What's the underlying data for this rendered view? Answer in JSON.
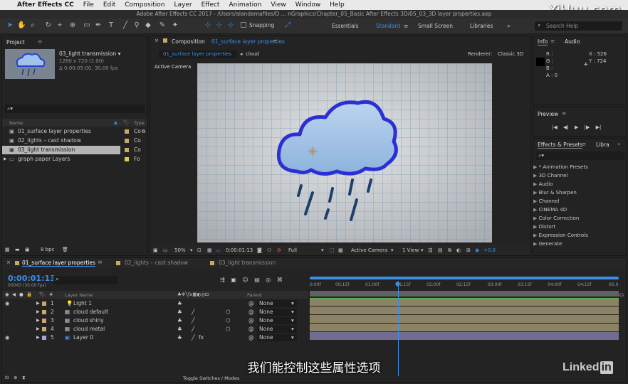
{
  "menubar": {
    "app": "After Effects CC",
    "items": [
      "File",
      "Edit",
      "Composition",
      "Layer",
      "Effect",
      "Animation",
      "View",
      "Window",
      "Help"
    ]
  },
  "watermark": "YiHuu.com",
  "window_title": "Adobe After Effects CC 2017 - /Users/alandemafiles/D ... nGraphics/Chapter_05_Basic After Effects 3D/05_03_3D layer properties.aep",
  "toolbar": {
    "snapping": "Snapping",
    "workspaces": [
      "Essentials",
      "Standard",
      "Small Screen",
      "Libraries"
    ],
    "search_placeholder": "Search Help"
  },
  "project": {
    "title": "Project",
    "thumb_name": "03_light transmission ▾",
    "thumb_res": "1280 x 720 (1.00)",
    "thumb_dur": "Δ 0:00:05:00, 30.00 fps",
    "search_icon": "⌕▾",
    "col_name": "Name",
    "col_type": "Type",
    "items": [
      {
        "name": "01_surface layer properties",
        "type": "Co"
      },
      {
        "name": "02_lights – cast shadow",
        "type": "Co"
      },
      {
        "name": "03_light transmission",
        "type": "Co"
      },
      {
        "name": "graph paper Layers",
        "type": "Fo"
      }
    ],
    "bpc": "8 bpc"
  },
  "composition": {
    "tab_prefix": "Composition",
    "tab_name": "01_surface layer properties",
    "crumb_active": "01_surface layer properties",
    "crumb_other": "cloud",
    "renderer_label": "Renderer:",
    "renderer": "Classic 3D",
    "active_camera": "Active Camera",
    "footer": {
      "zoom": "50%",
      "time": "0:00:01:13",
      "quality": "Full",
      "camera": "Active Camera",
      "views": "1 View",
      "exposure": "+0.0"
    }
  },
  "info": {
    "title": "Info",
    "audio_tab": "Audio",
    "r": "R :",
    "g": "G :",
    "b": "B :",
    "a": "A : 0",
    "x": "X : 526",
    "y": "Y : 724"
  },
  "preview": {
    "title": "Preview"
  },
  "effects": {
    "title": "Effects & Presets",
    "libra": "Libra",
    "search": "⌕▾",
    "items": [
      "* Animation Presets",
      "3D Channel",
      "Audio",
      "Blur & Sharpen",
      "Channel",
      "CINEMA 4D",
      "Color Correction",
      "Distort",
      "Expression Controls",
      "Generate"
    ]
  },
  "timeline": {
    "tabs": [
      "01_surface layer properties",
      "02_lights – cast shadow",
      "03_light transmission"
    ],
    "timecode": "0:00:01:13",
    "frames": "00043 (30.00 fps)",
    "col_layer_name": "Layer Name",
    "col_parent": "Parent",
    "ruler": [
      "0:00f",
      "00:15f",
      "01:00f",
      "01:15f",
      "02:00f",
      "02:15f",
      "03:00f",
      "03:15f",
      "04:00f",
      "04:15f",
      "05:0"
    ],
    "layers": [
      {
        "num": "1",
        "name": "Light 1",
        "parent": "None"
      },
      {
        "num": "2",
        "name": "cloud default",
        "parent": "None"
      },
      {
        "num": "3",
        "name": "cloud shiny",
        "parent": "None"
      },
      {
        "num": "4",
        "name": "cloud metal",
        "parent": "None"
      },
      {
        "num": "5",
        "name": "Layer 0",
        "parent": "None"
      }
    ],
    "toggle": "Toggle Switches / Modes"
  },
  "subtitle": "我们能控制这些属性选项",
  "linkedin": "Linked"
}
